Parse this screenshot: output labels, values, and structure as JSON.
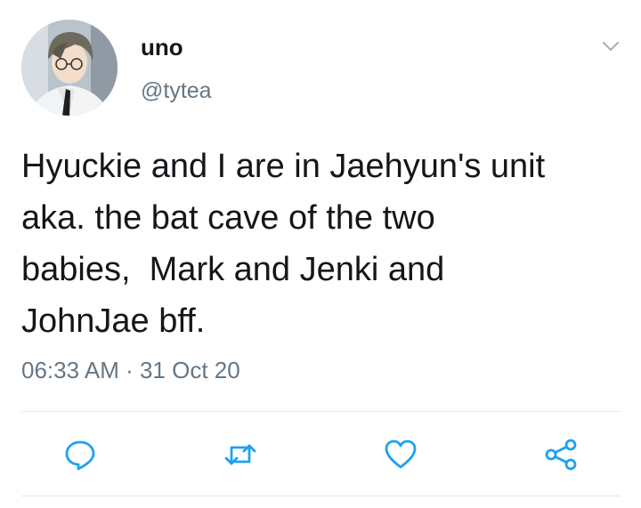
{
  "author": {
    "display_name": "uno",
    "handle": "@tytea",
    "avatar_icon": "anime-avatar"
  },
  "tweet": {
    "text": "Hyuckie and I are in Jaehyun's unit\naka. the bat cave of the two\nbabies,  Mark and Jenki and\nJohnJae bff.",
    "time": "06:33 AM",
    "separator": " · ",
    "date": "31 Oct 20"
  },
  "actions": [
    {
      "name": "reply",
      "icon": "reply-icon"
    },
    {
      "name": "retweet",
      "icon": "retweet-icon"
    },
    {
      "name": "like",
      "icon": "heart-icon"
    },
    {
      "name": "share",
      "icon": "share-icon"
    }
  ],
  "colors": {
    "text": "#14171a",
    "secondary": "#657786",
    "icon": "#1da1f2",
    "divider": "#e1e8ed"
  }
}
